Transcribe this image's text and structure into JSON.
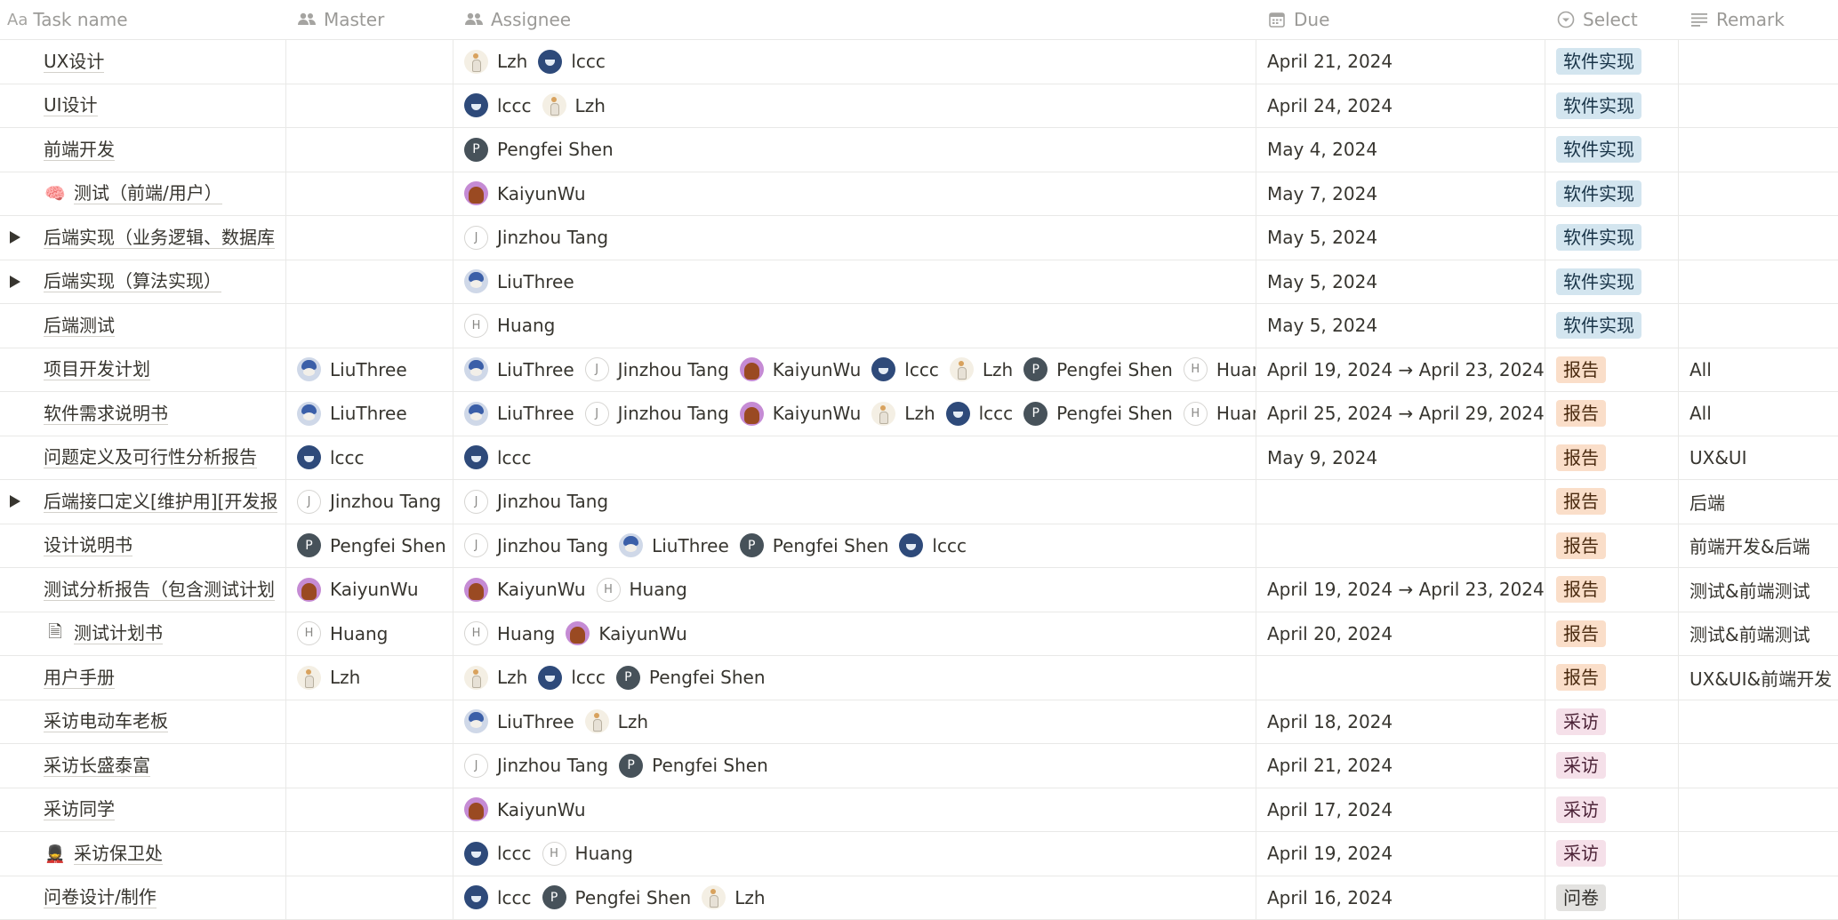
{
  "header": {
    "name_prefix": "Aa",
    "name": "Task name",
    "master": "Master",
    "assignee": "Assignee",
    "due": "Due",
    "select": "Select",
    "remark": "Remark",
    "icons": {
      "master": "people-icon",
      "assignee": "people-icon",
      "due": "calendar-icon",
      "select": "select-icon",
      "remark": "text-lines-icon"
    }
  },
  "tag_styles": {
    "软件实现": {
      "bg": "#d3e5ef",
      "fg": "#183347"
    },
    "报告": {
      "bg": "#fadec9",
      "fg": "#49290e"
    },
    "采访": {
      "bg": "#f5e0e9",
      "fg": "#4c2337"
    },
    "问卷": {
      "bg": "#e3e2e0",
      "fg": "#32302c"
    }
  },
  "rows": [
    {
      "name": "UX设计",
      "master": [],
      "assignee": [
        "Lzh",
        "lccc"
      ],
      "due": "April 21, 2024",
      "select": "软件实现",
      "remark": ""
    },
    {
      "name": "UI设计",
      "master": [],
      "assignee": [
        "lccc",
        "Lzh"
      ],
      "due": "April 24, 2024",
      "select": "软件实现",
      "remark": ""
    },
    {
      "name": "前端开发",
      "master": [],
      "assignee": [
        "Pengfei Shen"
      ],
      "due": "May 4, 2024",
      "select": "软件实现",
      "remark": ""
    },
    {
      "name": "测试（前端/用户）",
      "icon": "brain-icon",
      "icon_glyph": "🧠",
      "master": [],
      "assignee": [
        "KaiyunWu"
      ],
      "due": "May 7, 2024",
      "select": "软件实现",
      "remark": ""
    },
    {
      "name": "后端实现（业务逻辑、数据库",
      "toggle": true,
      "master": [],
      "assignee": [
        "Jinzhou Tang"
      ],
      "due": "May 5, 2024",
      "select": "软件实现",
      "remark": ""
    },
    {
      "name": "后端实现（算法实现）",
      "toggle": true,
      "master": [],
      "assignee": [
        "LiuThree"
      ],
      "due": "May 5, 2024",
      "select": "软件实现",
      "remark": ""
    },
    {
      "name": "后端测试",
      "master": [],
      "assignee": [
        "Huang"
      ],
      "due": "May 5, 2024",
      "select": "软件实现",
      "remark": ""
    },
    {
      "name": "项目开发计划",
      "master": [
        "LiuThree"
      ],
      "assignee": [
        "LiuThree",
        "Jinzhou Tang",
        "KaiyunWu",
        "lccc",
        "Lzh",
        "Pengfei Shen",
        "Huang"
      ],
      "due": "April 19, 2024 → April 23, 2024",
      "select": "报告",
      "remark": "All"
    },
    {
      "name": "软件需求说明书",
      "master": [
        "LiuThree"
      ],
      "assignee": [
        "LiuThree",
        "Jinzhou Tang",
        "KaiyunWu",
        "Lzh",
        "lccc",
        "Pengfei Shen",
        "Huang"
      ],
      "due": "April 25, 2024 → April 29, 2024",
      "select": "报告",
      "remark": "All"
    },
    {
      "name": "问题定义及可行性分析报告",
      "master": [
        "lccc"
      ],
      "assignee": [
        "lccc"
      ],
      "due": "May 9, 2024",
      "select": "报告",
      "remark": "UX&UI"
    },
    {
      "name": "后端接口定义[维护用][开发报",
      "toggle": true,
      "master": [
        "Jinzhou Tang"
      ],
      "assignee": [
        "Jinzhou Tang"
      ],
      "due": "",
      "select": "报告",
      "remark": "后端"
    },
    {
      "name": "设计说明书",
      "master": [
        "Pengfei Shen"
      ],
      "assignee": [
        "Jinzhou Tang",
        "LiuThree",
        "Pengfei Shen",
        "lccc"
      ],
      "due": "",
      "select": "报告",
      "remark": "前端开发&后端"
    },
    {
      "name": "测试分析报告（包含测试计划",
      "master": [
        "KaiyunWu"
      ],
      "assignee": [
        "KaiyunWu",
        "Huang"
      ],
      "due": "April 19, 2024 → April 23, 2024",
      "select": "报告",
      "remark": "测试&前端测试"
    },
    {
      "name": "测试计划书",
      "icon": "document-icon",
      "icon_glyph": "🗎",
      "master": [
        "Huang"
      ],
      "assignee": [
        "Huang",
        "KaiyunWu"
      ],
      "due": "April 20, 2024",
      "select": "报告",
      "remark": "测试&前端测试"
    },
    {
      "name": "用户手册",
      "master": [
        "Lzh"
      ],
      "assignee": [
        "Lzh",
        "lccc",
        "Pengfei Shen"
      ],
      "due": "",
      "select": "报告",
      "remark": "UX&UI&前端开发"
    },
    {
      "name": "采访电动车老板",
      "master": [],
      "assignee": [
        "LiuThree",
        "Lzh"
      ],
      "due": "April 18, 2024",
      "select": "采访",
      "remark": ""
    },
    {
      "name": "采访长盛泰富",
      "master": [],
      "assignee": [
        "Jinzhou Tang",
        "Pengfei Shen"
      ],
      "due": "April 21, 2024",
      "select": "采访",
      "remark": ""
    },
    {
      "name": "采访同学",
      "master": [],
      "assignee": [
        "KaiyunWu"
      ],
      "due": "April 17, 2024",
      "select": "采访",
      "remark": ""
    },
    {
      "name": "采访保卫处",
      "icon": "guard-icon",
      "icon_glyph": "💂",
      "master": [],
      "assignee": [
        "lccc",
        "Huang"
      ],
      "due": "April 19, 2024",
      "select": "采访",
      "remark": ""
    },
    {
      "name": "问卷设计/制作",
      "master": [],
      "assignee": [
        "lccc",
        "Pengfei Shen",
        "Lzh"
      ],
      "due": "April 16, 2024",
      "select": "问卷",
      "remark": ""
    }
  ]
}
